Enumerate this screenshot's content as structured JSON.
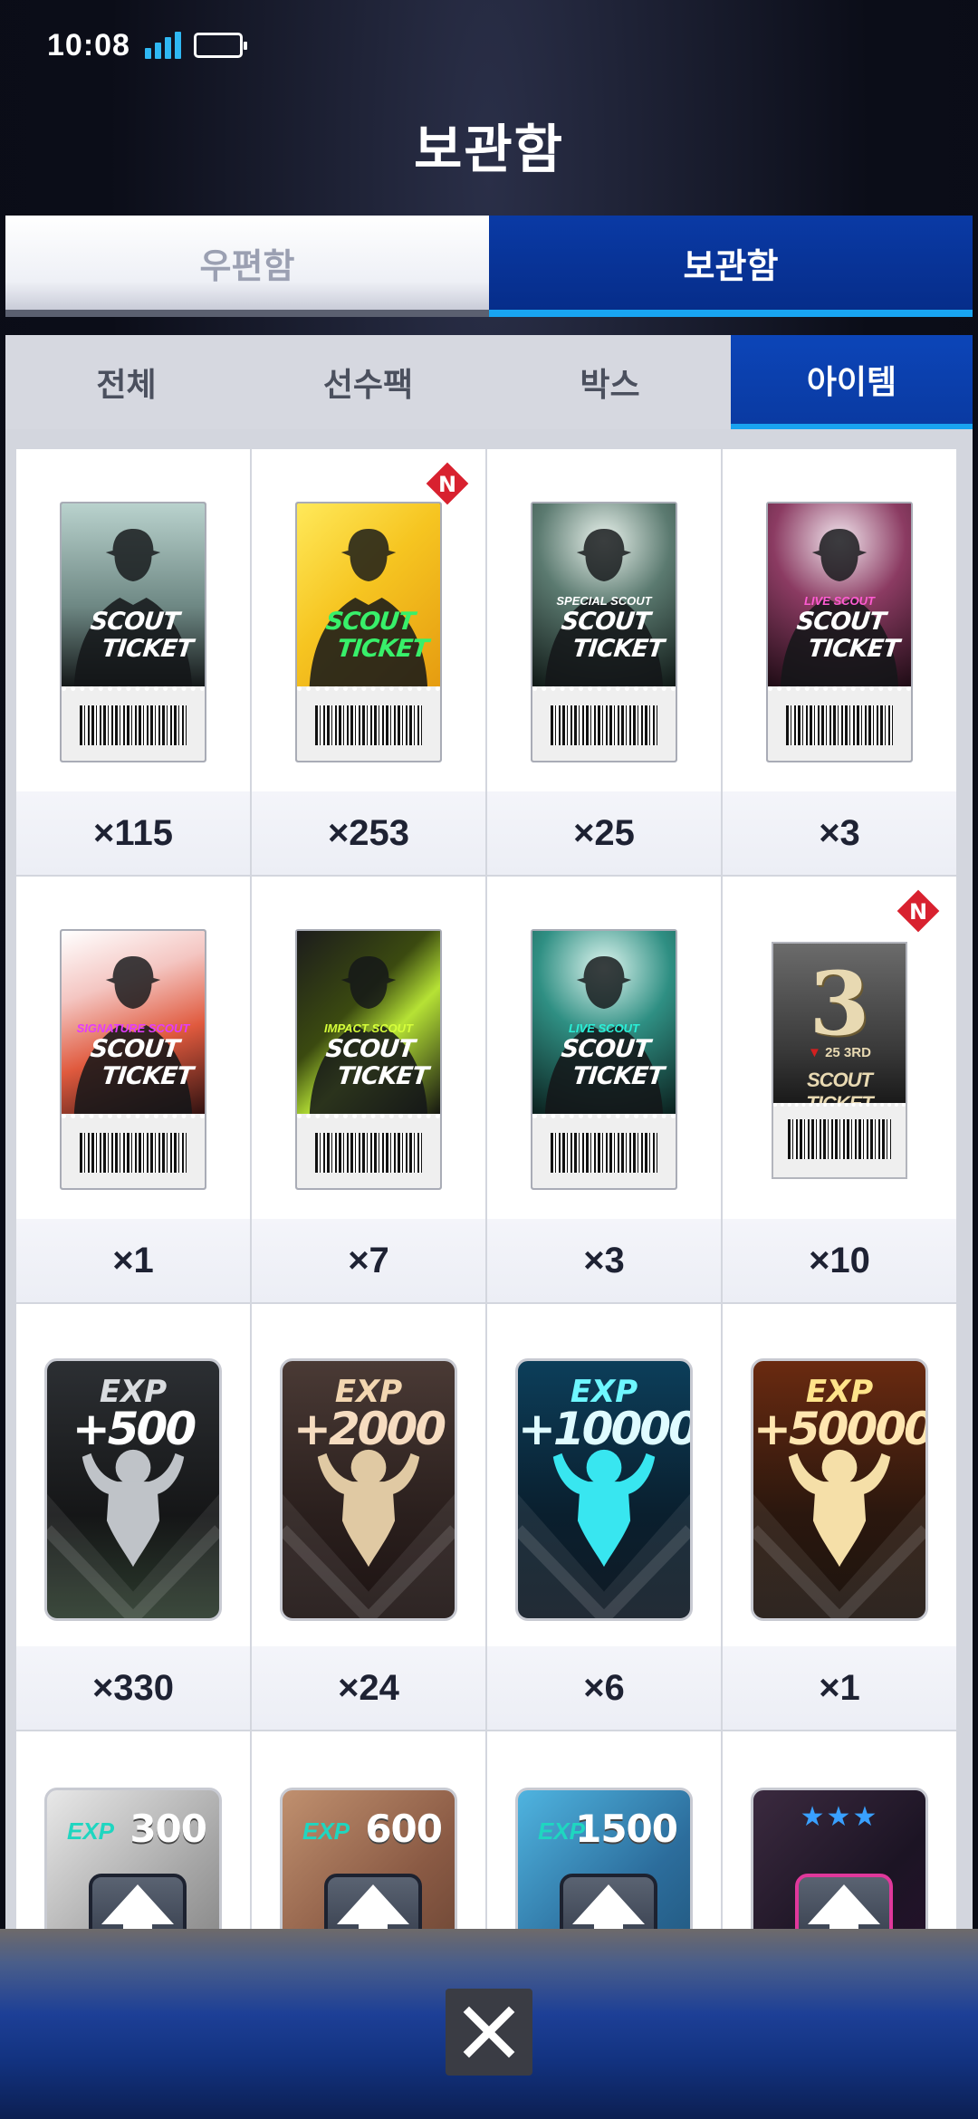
{
  "status_bar": {
    "time": "10:08"
  },
  "header": {
    "title": "보관함"
  },
  "top_tabs": [
    {
      "label": "우편함",
      "active": false
    },
    {
      "label": "보관함",
      "active": true
    }
  ],
  "sub_tabs": [
    {
      "label": "전체",
      "active": false
    },
    {
      "label": "선수팩",
      "active": false
    },
    {
      "label": "박스",
      "active": false
    },
    {
      "label": "아이템",
      "active": true
    }
  ],
  "ticket_text": {
    "line1": "SCOUT",
    "line2": "TICKET"
  },
  "items": [
    {
      "type": "scout-ticket",
      "variant": "basic",
      "count": "×115",
      "new": false
    },
    {
      "type": "scout-ticket",
      "variant": "gold",
      "count": "×253",
      "new": true
    },
    {
      "type": "scout-ticket",
      "variant": "special",
      "subtitle": "SPECIAL SCOUT",
      "count": "×25",
      "new": false
    },
    {
      "type": "scout-ticket",
      "variant": "live-red",
      "subtitle": "LIVE SCOUT",
      "count": "×3",
      "new": false
    },
    {
      "type": "scout-ticket",
      "variant": "signature",
      "subtitle": "SIGNATURE SCOUT",
      "count": "×1",
      "new": false
    },
    {
      "type": "scout-ticket",
      "variant": "impact",
      "subtitle": "IMPACT SCOUT",
      "count": "×7",
      "new": false
    },
    {
      "type": "scout-ticket",
      "variant": "live-teal",
      "subtitle": "LIVE SCOUT",
      "count": "×3",
      "new": false
    },
    {
      "type": "anniversary-ticket",
      "big": "3",
      "subtitle": "25 3RD",
      "label": "SCOUT TICKET",
      "count": "×10",
      "new": true
    },
    {
      "type": "exp-card",
      "exp": "EXP",
      "value": "+500",
      "count": "×330"
    },
    {
      "type": "exp-card",
      "exp": "EXP",
      "value": "+2000",
      "count": "×24"
    },
    {
      "type": "exp-card",
      "exp": "EXP",
      "value": "+10000",
      "count": "×6"
    },
    {
      "type": "exp-card",
      "exp": "EXP",
      "value": "+50000",
      "count": "×1"
    },
    {
      "type": "level-card",
      "exp": "EXP",
      "value": "300"
    },
    {
      "type": "level-card",
      "exp": "EXP",
      "value": "600"
    },
    {
      "type": "level-card",
      "exp": "EXP",
      "value": "1500"
    },
    {
      "type": "star-card",
      "stars": "★★★"
    }
  ],
  "badge_letter": "N",
  "colors": {
    "accent": "#0a3aa5",
    "accent_line": "#18a4f2",
    "signal": "#2fb8f3"
  }
}
